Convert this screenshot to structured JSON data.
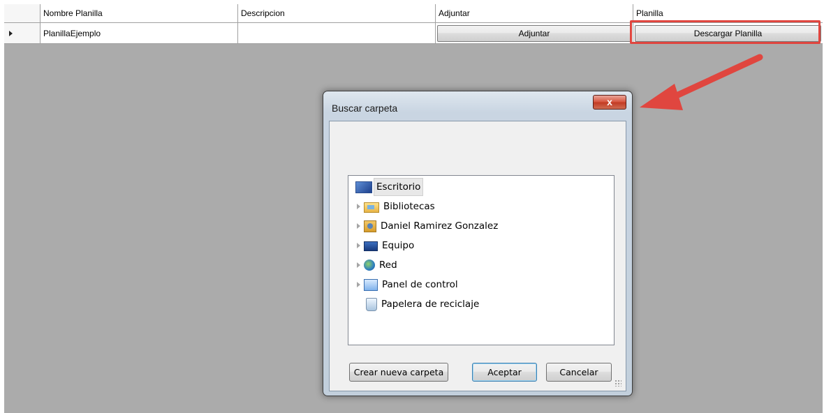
{
  "grid": {
    "columns": [
      "Nombre Planilla",
      "Descripcion",
      "Adjuntar",
      "Planilla"
    ],
    "rows": [
      {
        "name": "PlanillaEjemplo",
        "description": "",
        "attach_button": "Adjuntar",
        "download_button": "Descargar Planilla"
      }
    ]
  },
  "dialog": {
    "title": "Buscar carpeta",
    "close_label": "x",
    "tree": [
      {
        "label": "Escritorio",
        "icon": "desktop-icon",
        "selected": true
      },
      {
        "label": "Bibliotecas",
        "icon": "libraries-folder-icon"
      },
      {
        "label": "Daniel Ramirez Gonzalez",
        "icon": "user-folder-icon"
      },
      {
        "label": "Equipo",
        "icon": "computer-icon"
      },
      {
        "label": "Red",
        "icon": "network-icon"
      },
      {
        "label": "Panel de control",
        "icon": "control-panel-icon"
      },
      {
        "label": "Papelera de reciclaje",
        "icon": "recycle-bin-icon"
      }
    ],
    "buttons": {
      "new_folder": "Crear nueva carpeta",
      "ok": "Aceptar",
      "cancel": "Cancelar"
    }
  },
  "colors": {
    "annotation": "#e0463f",
    "grid_background": "#ababab"
  }
}
